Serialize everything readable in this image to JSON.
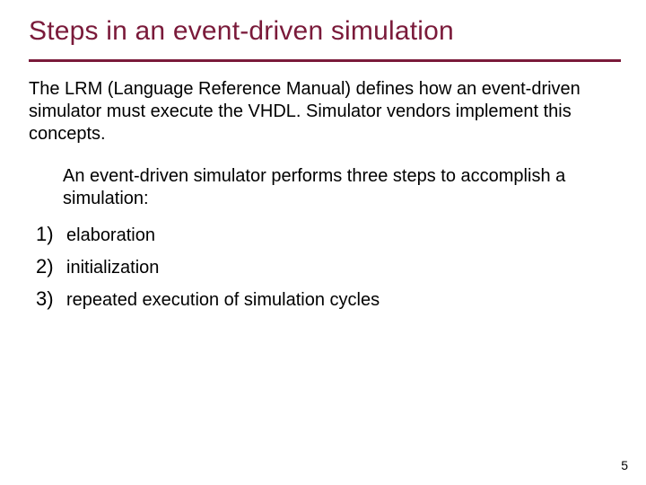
{
  "title": "Steps in an event-driven simulation",
  "intro": "The LRM (Language Reference Manual) defines how an event-driven simulator must execute the VHDL. Simulator vendors implement this concepts.",
  "subintro": "An event-driven simulator performs three steps to accomplish a simulation:",
  "steps": [
    {
      "num": "1)",
      "label": "elaboration"
    },
    {
      "num": "2)",
      "label": "initialization"
    },
    {
      "num": "3)",
      "label": "repeated execution of simulation cycles"
    }
  ],
  "page_number": "5"
}
